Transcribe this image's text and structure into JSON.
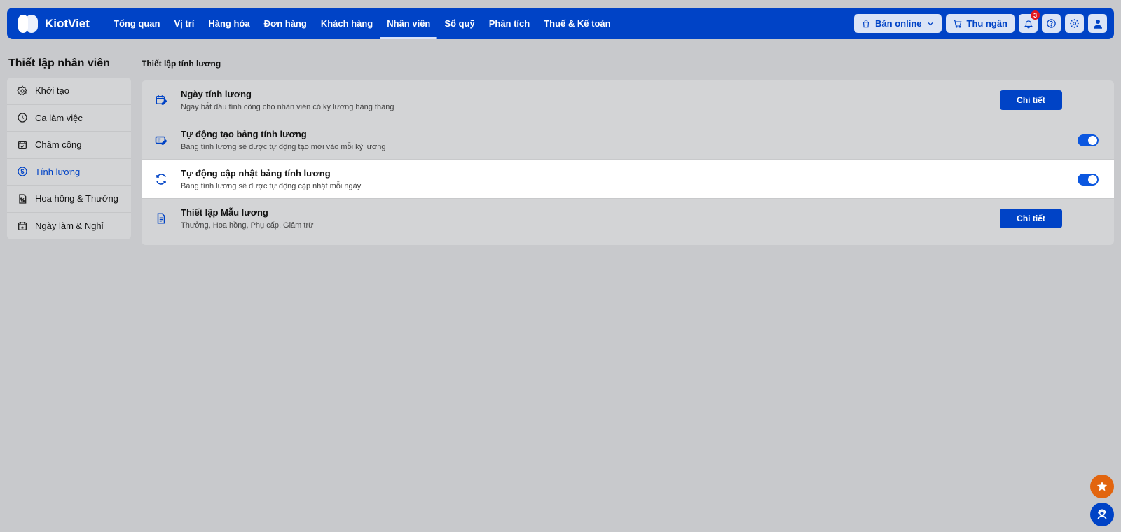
{
  "brand": {
    "name": "KiotViet"
  },
  "nav": {
    "items": [
      {
        "label": "Tổng quan",
        "active": false
      },
      {
        "label": "Vị trí",
        "active": false
      },
      {
        "label": "Hàng hóa",
        "active": false
      },
      {
        "label": "Đơn hàng",
        "active": false
      },
      {
        "label": "Khách hàng",
        "active": false
      },
      {
        "label": "Nhân viên",
        "active": true
      },
      {
        "label": "Sổ quỹ",
        "active": false
      },
      {
        "label": "Phân tích",
        "active": false
      },
      {
        "label": "Thuế & Kế toán",
        "active": false
      }
    ],
    "sell_online_label": "Bán online",
    "cashier_label": "Thu ngân",
    "notification_count": "3"
  },
  "sidebar": {
    "title": "Thiết lập nhân viên",
    "items": [
      {
        "label": "Khởi tạo",
        "icon": "gear-icon",
        "active": false
      },
      {
        "label": "Ca làm việc",
        "icon": "clock-icon",
        "active": false
      },
      {
        "label": "Chấm công",
        "icon": "calendar-check-icon",
        "active": false
      },
      {
        "label": "Tính lương",
        "icon": "dollar-circle-icon",
        "active": true
      },
      {
        "label": "Hoa hồng & Thưởng",
        "icon": "percent-doc-icon",
        "active": false
      },
      {
        "label": "Ngày làm & Nghỉ",
        "icon": "calendar-star-icon",
        "active": false
      }
    ]
  },
  "main": {
    "title": "Thiết lập tính lương",
    "rows": [
      {
        "title": "Ngày tính lương",
        "desc": "Ngày bắt đầu tính công cho nhân viên có kỳ lương hàng tháng",
        "action": "button",
        "button_label": "Chi tiết"
      },
      {
        "title": "Tự động tạo bảng tính lương",
        "desc": "Bảng tính lương sẽ được tự động tạo mới vào mỗi kỳ lương",
        "action": "toggle",
        "enabled": true
      },
      {
        "title": "Tự động cập nhật bảng tính lương",
        "desc": "Bảng tính lương sẽ được tự động cập nhật mỗi ngày",
        "action": "toggle",
        "enabled": true
      },
      {
        "title": "Thiết lập Mẫu lương",
        "desc": "Thưởng, Hoa hồng, Phụ cấp, Giảm trừ",
        "action": "button",
        "button_label": "Chi tiết"
      }
    ]
  },
  "colors": {
    "primary": "#0043c6",
    "background": "#c8c9cc",
    "fab_orange": "#e2650f"
  }
}
